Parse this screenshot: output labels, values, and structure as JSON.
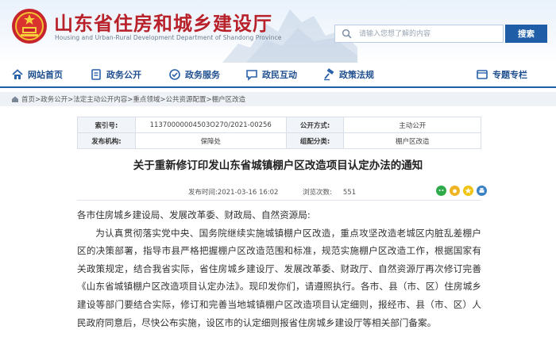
{
  "header": {
    "title": "山东省住房和城乡建设厅",
    "subtitle": "Housing and Urban-Rural Development Department of Shandong Province",
    "search": {
      "placeholder": "请输入您想了解的内容",
      "button_label": "搜索"
    }
  },
  "nav": {
    "items": [
      {
        "label": "网站首页",
        "icon": "home-icon"
      },
      {
        "label": "政务公开",
        "icon": "document-icon"
      },
      {
        "label": "政务服务",
        "icon": "service-icon"
      },
      {
        "label": "政民互动",
        "icon": "chat-icon"
      },
      {
        "label": "政策法规",
        "icon": "gavel-icon"
      },
      {
        "label": "专题专栏",
        "icon": "topic-icon"
      }
    ]
  },
  "breadcrumb": {
    "home": "首页",
    "trail": "首页>政务公开>法定主动公开内容>重点领域>公共资源配置>棚户区改造"
  },
  "meta": {
    "index_label": "索引号:",
    "index_value": "11370000004503O270/2021-00256",
    "disclosure_label": "公开方式:",
    "disclosure_value": "主动公开",
    "publisher_label": "发布机构:",
    "publisher_value": "保障处",
    "category_label": "组配分类:",
    "category_value": "棚户区改造"
  },
  "article": {
    "title": "关于重新修订印发山东省城镇棚户区改造项目认定办法的通知",
    "published": "发布时间:2021-03-16 16:02",
    "views_label": "浏览次数:",
    "views_count": "551",
    "salutation": "各市住房城乡建设局、发展改革委、财政局、自然资源局:",
    "paragraph": "为认真贯彻落实党中央、国务院继续实施城镇棚户区改造，重点攻坚改造老城区内脏乱差棚户区的决策部署，指导市县严格把握棚户区改造范围和标准，规范实施棚户区改造工作，根据国家有关政策规定，结合我省实际，省住房城乡建设厅、发展改革委、财政厅、自然资源厅再次修订完善《山东省城镇棚户区改造项目认定办法》。现印发你们，请遵照执行。各市、县（市、区）住房城乡建设等部门要结合实际，修订和完善当地城镇棚户区改造项目认定细则，报经市、县（市、区）人民政府同意后，尽快公布实施，设区市的认定细则报省住房城乡建设厅等相关部门备案。"
  },
  "colors": {
    "brand_red": "#b8202a",
    "brand_blue": "#1f5ea7"
  }
}
